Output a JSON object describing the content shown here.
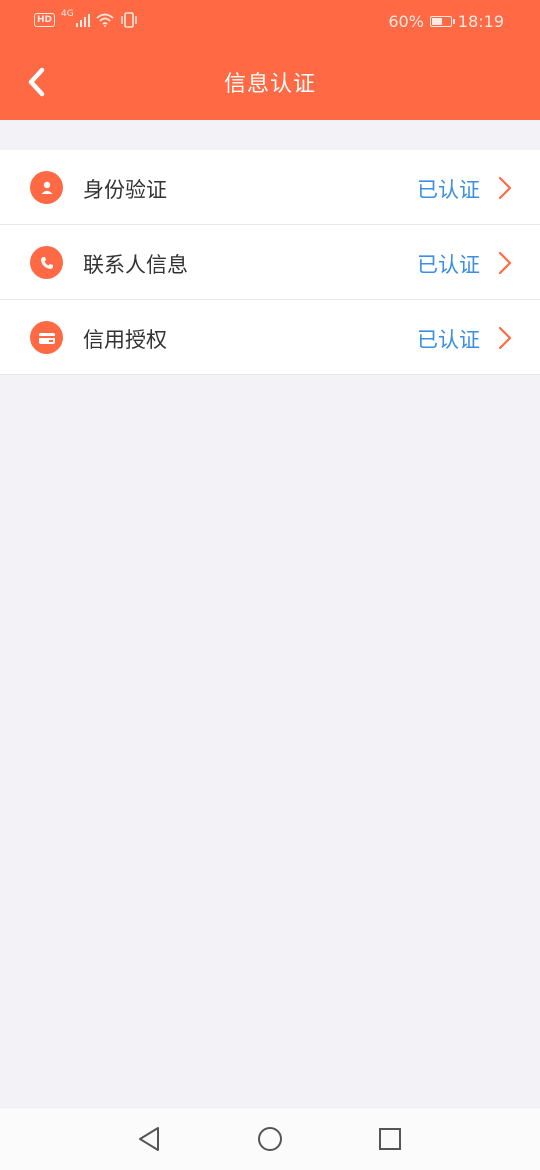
{
  "status_bar": {
    "hd": "HD",
    "network": "4G",
    "battery": "60%",
    "battery_level": 0.6,
    "time": "18:19"
  },
  "header": {
    "title": "信息认证",
    "back_icon": "chevron-left-icon"
  },
  "colors": {
    "primary": "#ff6a45",
    "status_text": "#3a8ee6",
    "background": "#f3f3f7"
  },
  "items": [
    {
      "label": "身份验证",
      "status": "已认证",
      "icon": "user-icon"
    },
    {
      "label": "联系人信息",
      "status": "已认证",
      "icon": "phone-icon"
    },
    {
      "label": "信用授权",
      "status": "已认证",
      "icon": "card-icon"
    }
  ],
  "nav_bar": {
    "back": "triangle-back-icon",
    "home": "circle-home-icon",
    "recent": "square-recent-icon"
  }
}
